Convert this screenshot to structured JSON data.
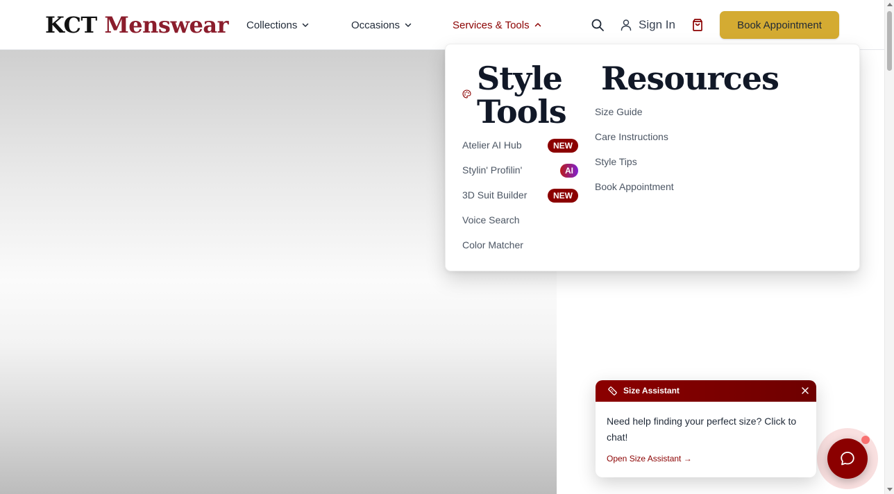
{
  "header": {
    "logo": {
      "brand": "KCT",
      "suffix": "Menswear"
    },
    "nav": [
      {
        "label": "Collections",
        "icon": "chevron-down-icon"
      },
      {
        "label": "Occasions",
        "icon": "chevron-down-icon"
      },
      {
        "label": "Services & Tools",
        "icon": "chevron-up-icon",
        "active": true
      }
    ],
    "search_icon": "search-icon",
    "user_icon": "user-icon",
    "sign_in_label": "Sign In",
    "cart_icon": "shopping-bag-icon",
    "book_button_label": "Book Appointment"
  },
  "dropdown": {
    "style_tools": {
      "heading": "Style Tools",
      "icon": "palette-icon",
      "items": [
        {
          "label": "Atelier AI Hub",
          "badge": "NEW"
        },
        {
          "label": "Stylin' Profilin'",
          "badge": "AI"
        },
        {
          "label": "3D Suit Builder",
          "badge": "NEW"
        },
        {
          "label": "Voice Search"
        },
        {
          "label": "Color Matcher"
        }
      ]
    },
    "resources": {
      "heading": "Resources",
      "items": [
        {
          "label": "Size Guide"
        },
        {
          "label": "Care Instructions"
        },
        {
          "label": "Style Tips"
        },
        {
          "label": "Book Appointment"
        }
      ]
    }
  },
  "size_assistant": {
    "title": "Size Assistant",
    "icon": "ruler-icon",
    "message": "Need help finding your perfect size? Click to chat!",
    "link_label": "Open Size Assistant →",
    "close_icon": "close-icon"
  },
  "chat_button": {
    "icon": "chat-icon"
  },
  "colors": {
    "brand_red": "#8b0000",
    "logo_red": "#8b1d2c",
    "gold_button": "#d4ab32",
    "ai_badge_gradient": [
      "#b91c1c",
      "#7e22ce"
    ]
  }
}
